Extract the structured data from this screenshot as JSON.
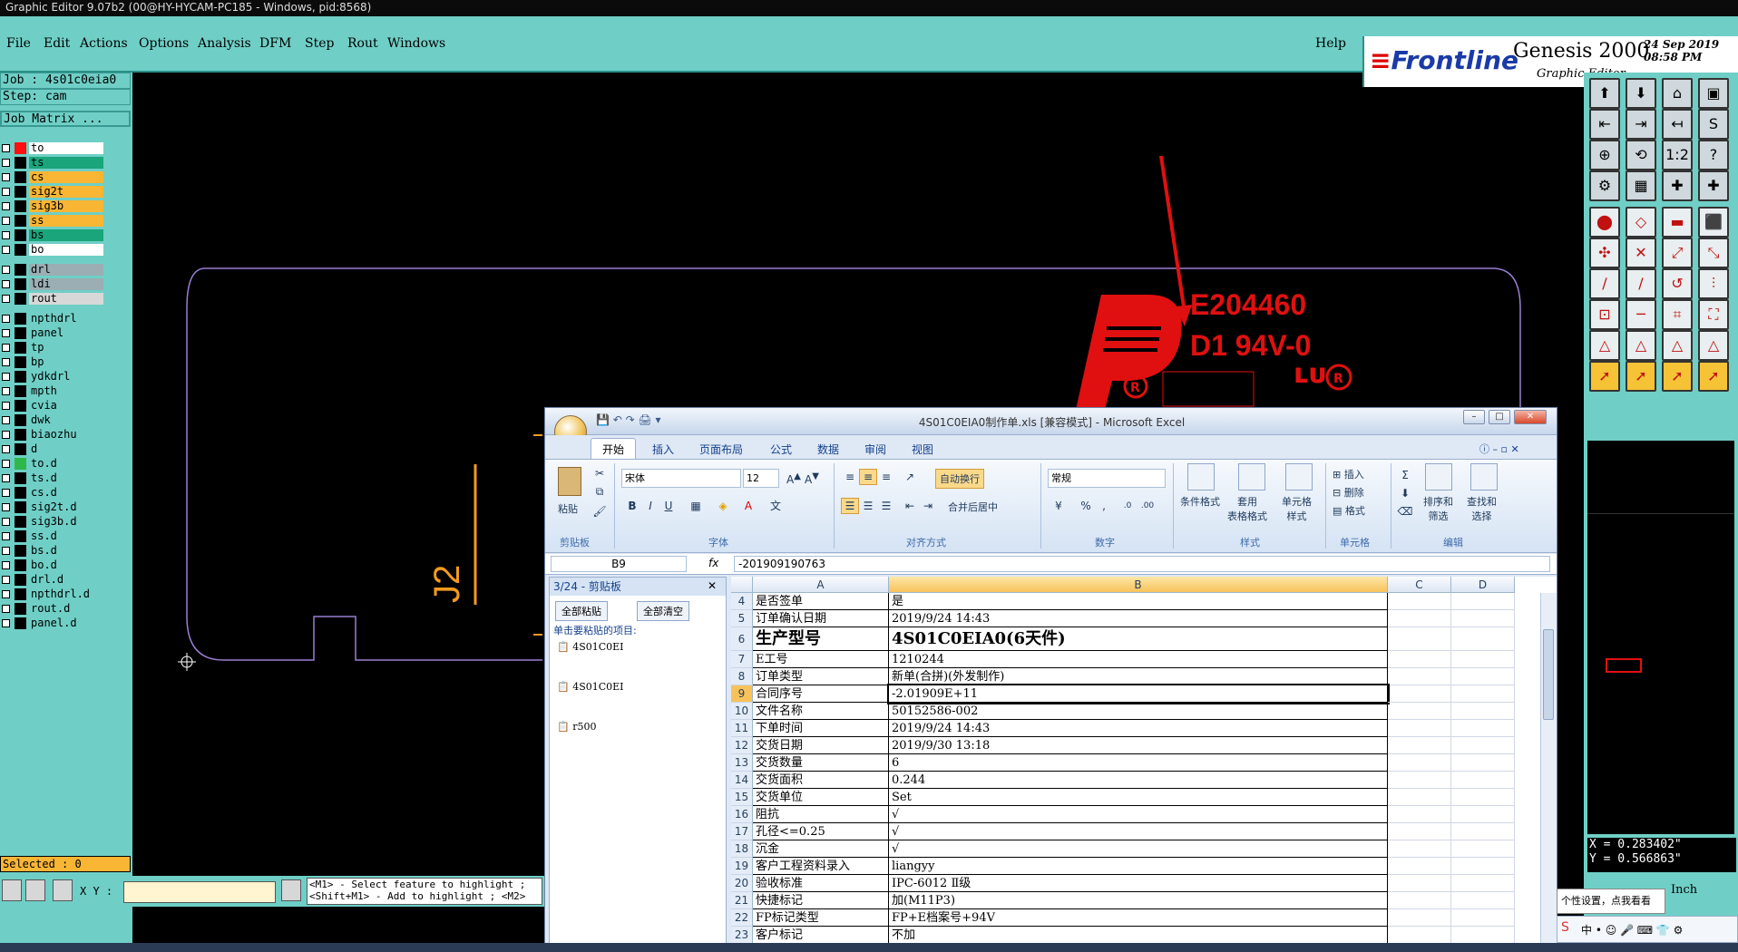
{
  "window_title": "Graphic Editor 9.07b2 (00@HY-HYCAM-PC185 - Windows, pid:8568)",
  "menu": [
    "File",
    "Edit",
    "Actions",
    "Options",
    "Analysis",
    "DFM",
    "Step",
    "Rout",
    "Windows"
  ],
  "help_label": "Help",
  "logo": {
    "brand": "Frontline",
    "product": "Genesis 2000",
    "subtitle": "Graphic Editor",
    "date": "24 Sep 2019",
    "time": "08:58 PM"
  },
  "job": "Job : 4s01c0eia0",
  "step": "Step: cam",
  "job_matrix": "Job Matrix ...",
  "layers": [
    {
      "name": "to",
      "color": "#ffffff",
      "sw": "#ff1010"
    },
    {
      "name": "ts",
      "color": "#1aa57a",
      "sw": "#000000"
    },
    {
      "name": "cs",
      "color": "#f9b534",
      "sw": "#000000"
    },
    {
      "name": "sig2t",
      "color": "#f9b534",
      "sw": "#000000"
    },
    {
      "name": "sig3b",
      "color": "#f9b534",
      "sw": "#000000"
    },
    {
      "name": "ss",
      "color": "#f9b534",
      "sw": "#000000"
    },
    {
      "name": "bs",
      "color": "#1aa57a",
      "sw": "#000000"
    },
    {
      "name": "bo",
      "color": "#ffffff",
      "sw": "#000000"
    },
    {
      "name": "drl",
      "color": "#9aaeb3",
      "sw": "#000000"
    },
    {
      "name": "ldi",
      "color": "#9aaeb3",
      "sw": "#000000"
    },
    {
      "name": "rout",
      "color": "#d8d8d8",
      "sw": "#000000"
    },
    {
      "name": "npthdrl",
      "color": "#6fcfc6",
      "sw": "#000000"
    },
    {
      "name": "panel",
      "color": "#6fcfc6",
      "sw": "#000000"
    },
    {
      "name": "tp",
      "color": "#6fcfc6",
      "sw": "#000000"
    },
    {
      "name": "bp",
      "color": "#6fcfc6",
      "sw": "#000000"
    },
    {
      "name": "ydkdrl",
      "color": "#6fcfc6",
      "sw": "#000000"
    },
    {
      "name": "mpth",
      "color": "#6fcfc6",
      "sw": "#000000"
    },
    {
      "name": "cvia",
      "color": "#6fcfc6",
      "sw": "#000000"
    },
    {
      "name": "dwk",
      "color": "#6fcfc6",
      "sw": "#000000"
    },
    {
      "name": "biaozhu",
      "color": "#6fcfc6",
      "sw": "#000000"
    },
    {
      "name": "d",
      "color": "#6fcfc6",
      "sw": "#000000"
    },
    {
      "name": "to.d",
      "color": "#6fcfc6",
      "sw": "#2fb84a"
    },
    {
      "name": "ts.d",
      "color": "#6fcfc6",
      "sw": "#000000"
    },
    {
      "name": "cs.d",
      "color": "#6fcfc6",
      "sw": "#000000"
    },
    {
      "name": "sig2t.d",
      "color": "#6fcfc6",
      "sw": "#000000"
    },
    {
      "name": "sig3b.d",
      "color": "#6fcfc6",
      "sw": "#000000"
    },
    {
      "name": "ss.d",
      "color": "#6fcfc6",
      "sw": "#000000"
    },
    {
      "name": "bs.d",
      "color": "#6fcfc6",
      "sw": "#000000"
    },
    {
      "name": "bo.d",
      "color": "#6fcfc6",
      "sw": "#000000"
    },
    {
      "name": "drl.d",
      "color": "#6fcfc6",
      "sw": "#000000"
    },
    {
      "name": "npthdrl.d",
      "color": "#6fcfc6",
      "sw": "#000000"
    },
    {
      "name": "rout.d",
      "color": "#6fcfc6",
      "sw": "#000000"
    },
    {
      "name": "panel.d",
      "color": "#6fcfc6",
      "sw": "#000000"
    }
  ],
  "selected": "Selected : 0",
  "xy_label": "X Y :",
  "hint_lines": [
    "<M1> - Select feature to highlight ;",
    "<Shift+M1> - Add to highlight ; <M2>"
  ],
  "coords": {
    "x": "X = 0.283402\"",
    "y": "Y = 0.566863\""
  },
  "units": "Inch",
  "canvas": {
    "label_j2": "J2",
    "ul_code": "E204460",
    "ul_rating": "D1  94V-0"
  },
  "excel": {
    "title": "4S01C0EIA0制作单.xls  [兼容模式] - Microsoft Excel",
    "tabs": [
      "开始",
      "插入",
      "页面布局",
      "公式",
      "数据",
      "审阅",
      "视图"
    ],
    "ribbon": {
      "paste": "粘贴",
      "clipboard_group": "剪贴板",
      "font_name": "宋体",
      "font_size": "12",
      "font_group": "字体",
      "wrap": "自动换行",
      "merge": "合并后居中",
      "align_group": "对齐方式",
      "num_format": "常规",
      "number_group": "数字",
      "cond_format": "条件格式",
      "table_format": "套用\n表格格式",
      "cell_style": "单元格\n样式",
      "style_group": "样式",
      "insert": "插入",
      "delete": "删除",
      "format": "格式",
      "cells_group": "单元格",
      "sort": "排序和\n筛选",
      "find": "查找和\n选择",
      "edit_group": "编辑"
    },
    "name_box": "B9",
    "formula": "-201909190763",
    "clipboard": {
      "title": "3/24 - 剪贴板",
      "paste_all": "全部粘贴",
      "clear_all": "全部清空",
      "hint": "单击要粘贴的项目:",
      "items": [
        "4S01C0EI",
        "4S01C0EI",
        "r500"
      ]
    },
    "columns": [
      "A",
      "B",
      "C",
      "D"
    ],
    "rows": [
      {
        "n": "4",
        "a": "是否签单",
        "b": "是"
      },
      {
        "n": "5",
        "a": "订单确认日期",
        "b": "2019/9/24 14:43"
      },
      {
        "n": "6",
        "a": "生产型号",
        "b": "4S01C0EIA0(6天件)"
      },
      {
        "n": "7",
        "a": "E工号",
        "b": "1210244"
      },
      {
        "n": "8",
        "a": "订单类型",
        "b": "新单(合拼)(外发制作)"
      },
      {
        "n": "9",
        "a": "合同序号",
        "b": "-2.01909E+11"
      },
      {
        "n": "10",
        "a": "文件名称",
        "b": "50152586-002"
      },
      {
        "n": "11",
        "a": "下单时间",
        "b": "2019/9/24 14:43"
      },
      {
        "n": "12",
        "a": "交货日期",
        "b": "2019/9/30 13:18"
      },
      {
        "n": "13",
        "a": "交货数量",
        "b": "6"
      },
      {
        "n": "14",
        "a": "交货面积",
        "b": "0.244"
      },
      {
        "n": "15",
        "a": "交货单位",
        "b": "Set"
      },
      {
        "n": "16",
        "a": "阻抗",
        "b": "√"
      },
      {
        "n": "17",
        "a": "孔径<=0.25",
        "b": "√"
      },
      {
        "n": "18",
        "a": "沉金",
        "b": "√"
      },
      {
        "n": "19",
        "a": "客户工程资料录入",
        "b": "liangyy"
      },
      {
        "n": "20",
        "a": "验收标准",
        "b": "IPC-6012 Ⅱ级"
      },
      {
        "n": "21",
        "a": "快捷标记",
        "b": "加(M11P3)"
      },
      {
        "n": "22",
        "a": "FP标记类型",
        "b": "FP+E档案号+94V"
      },
      {
        "n": "23",
        "a": "客户标记",
        "b": "不加"
      }
    ]
  },
  "tray_tip": "个性设置，点我看看",
  "colors": {
    "app_bg": "#6fcfc6",
    "canvas_bg": "#000000",
    "red": "#e01010",
    "orange": "#f39a1e",
    "outline": "#9b7fd1"
  }
}
